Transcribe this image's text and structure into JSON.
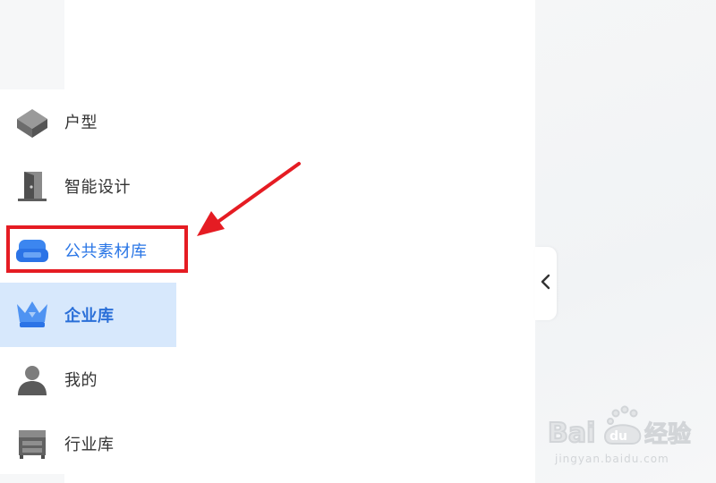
{
  "menu": {
    "items": [
      {
        "key": "floorplan",
        "label": "户型",
        "icon": "cube-icon",
        "state": "normal"
      },
      {
        "key": "smart-design",
        "label": "智能设计",
        "icon": "door-icon",
        "state": "normal"
      },
      {
        "key": "public-library",
        "label": "公共素材库",
        "icon": "sofa-icon",
        "state": "highlighted"
      },
      {
        "key": "enterprise-library",
        "label": "企业库",
        "icon": "crown-icon",
        "state": "active"
      },
      {
        "key": "mine",
        "label": "我的",
        "icon": "user-icon",
        "state": "normal"
      },
      {
        "key": "industry-library",
        "label": "行业库",
        "icon": "cabinet-icon",
        "state": "normal"
      }
    ]
  },
  "collapse_button": {
    "icon": "chevron-left-icon"
  },
  "annotation": {
    "box_color": "#e51c23",
    "arrow_color": "#e51c23",
    "target": "public-library"
  },
  "colors": {
    "active_bg": "#d7e8fc",
    "active_text": "#2a6fd8",
    "accent_blue": "#2a76e6"
  },
  "watermark": {
    "logo_text": "Baidu经验",
    "url": "jingyan.baidu.com"
  }
}
